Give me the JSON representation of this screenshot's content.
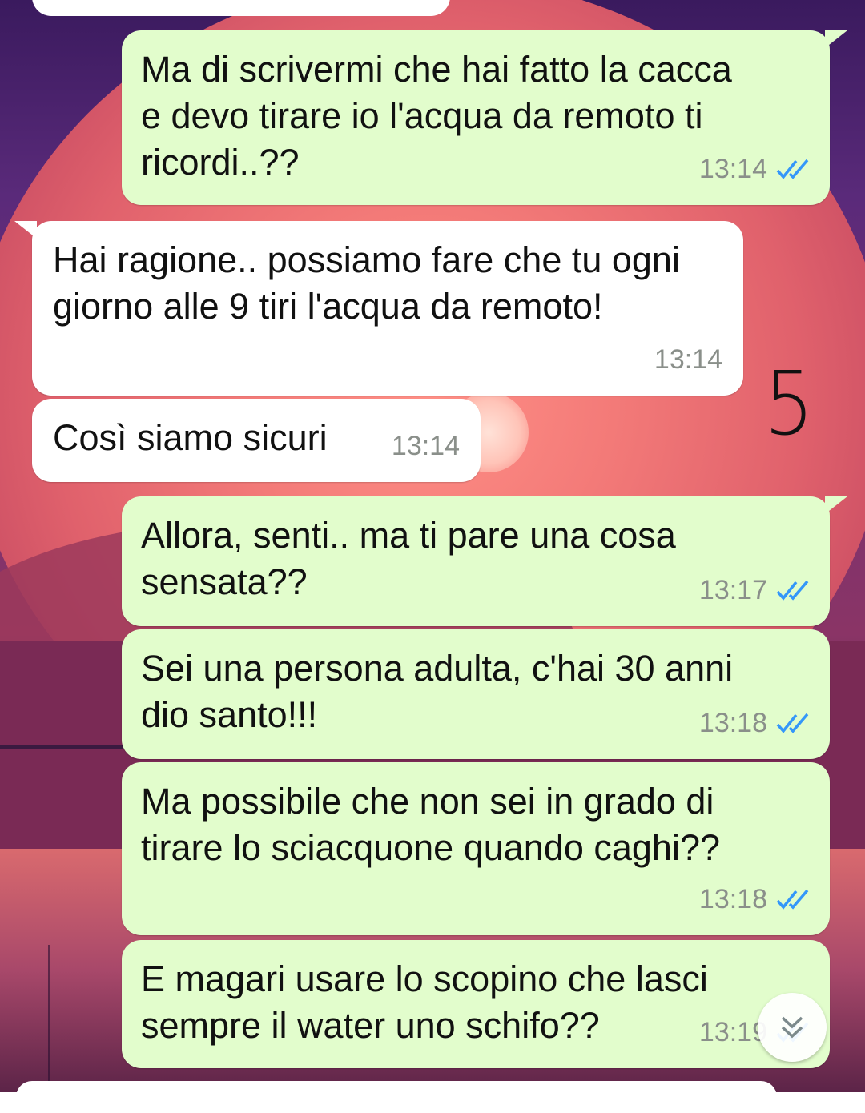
{
  "annotation": "5",
  "messages": [
    {
      "direction": "outgoing",
      "text": "Ma di scrivermi che hai fatto la cacca\ne devo tirare io l'acqua da remoto ti\nricordi..??",
      "time": "13:14",
      "status": "read"
    },
    {
      "direction": "incoming",
      "text": "Hai ragione.. possiamo fare che tu ogni\ngiorno alle 9 tiri l'acqua da remoto!",
      "time": "13:14"
    },
    {
      "direction": "incoming",
      "text": "Così siamo sicuri",
      "time": "13:14"
    },
    {
      "direction": "outgoing",
      "text": "Allora, senti.. ma ti pare una cosa\nsensata??",
      "time": "13:17",
      "status": "read"
    },
    {
      "direction": "outgoing",
      "text": "Sei una persona adulta, c'hai 30 anni\ndio santo!!!",
      "time": "13:18",
      "status": "read"
    },
    {
      "direction": "outgoing",
      "text": "Ma possibile che non sei in grado di\ntirare lo sciacquone quando caghi??",
      "time": "13:18",
      "status": "read"
    },
    {
      "direction": "outgoing",
      "text": "E magari usare lo scopino che lasci\nsempre il water uno schifo??",
      "time": "13:19",
      "status": "read"
    }
  ],
  "icons": {
    "read_receipt": "double-check-icon",
    "scroll": "chevron-double-down-icon"
  },
  "colors": {
    "outgoing_bubble": "#e2fdcc",
    "incoming_bubble": "#ffffff",
    "read_tick": "#3497f9",
    "time_text": "#8a8f8a"
  }
}
